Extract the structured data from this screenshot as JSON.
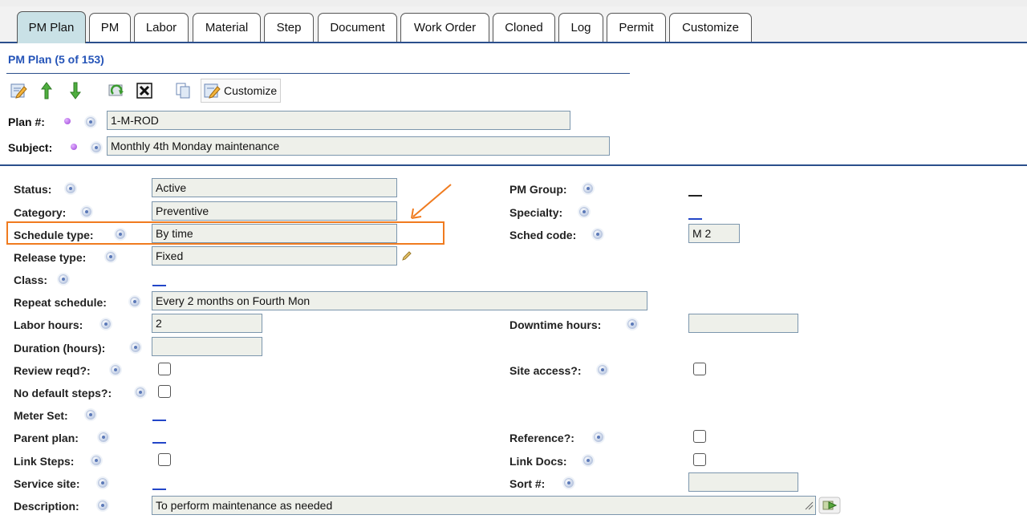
{
  "tabs": [
    "PM Plan",
    "PM",
    "Labor",
    "Material",
    "Step",
    "Document",
    "Work Order",
    "Cloned",
    "Log",
    "Permit",
    "Customize"
  ],
  "active_tab": "PM Plan",
  "record_title": "PM Plan (5 of 153)",
  "toolbar": {
    "customize_label": "Customize"
  },
  "header_fields": {
    "plan_label": "Plan #:",
    "plan_value": "1-M-ROD",
    "subject_label": "Subject:",
    "subject_value": "Monthly 4th Monday maintenance"
  },
  "left_fields": {
    "status_label": "Status:",
    "status_value": "Active",
    "category_label": "Category:",
    "category_value": "Preventive",
    "schedule_type_label": "Schedule type:",
    "schedule_type_value": "By time",
    "release_type_label": "Release type:",
    "release_type_value": "Fixed",
    "class_label": "Class:",
    "repeat_schedule_label": "Repeat schedule:",
    "repeat_schedule_value": "Every 2 months on Fourth Mon",
    "labor_hours_label": "Labor hours:",
    "labor_hours_value": "2",
    "duration_label": "Duration (hours):",
    "duration_value": "",
    "review_reqd_label": "Review reqd?:",
    "no_default_steps_label": "No default steps?:",
    "meter_set_label": "Meter Set:",
    "parent_plan_label": "Parent plan:",
    "link_steps_label": "Link Steps:",
    "service_site_label": "Service site:",
    "description_label": "Description:",
    "description_value": "To perform maintenance as needed"
  },
  "right_fields": {
    "pm_group_label": "PM Group:",
    "specialty_label": "Specialty:",
    "sched_code_label": "Sched code:",
    "sched_code_value": "M 2",
    "downtime_hours_label": "Downtime hours:",
    "downtime_hours_value": "",
    "site_access_label": "Site access?:",
    "reference_label": "Reference?:",
    "link_docs_label": "Link Docs:",
    "sort_label": "Sort #:",
    "sort_value": ""
  },
  "colors": {
    "accent_blue": "#2b4f8c",
    "title_blue": "#2554b8",
    "active_tab": "#c9e1e6",
    "field_bg": "#eef0ea",
    "highlight_orange": "#f07b1f"
  },
  "icons": {
    "edit": "edit-note-icon",
    "previous": "arrow-up-icon",
    "next": "arrow-down-icon",
    "refresh": "refresh-icon",
    "delete": "close-box-icon",
    "copy": "copy-icon",
    "customize": "customize-icon",
    "required": "required-dot-icon",
    "help": "help-icon",
    "pencil": "pencil-icon",
    "go": "go-arrow-icon"
  }
}
